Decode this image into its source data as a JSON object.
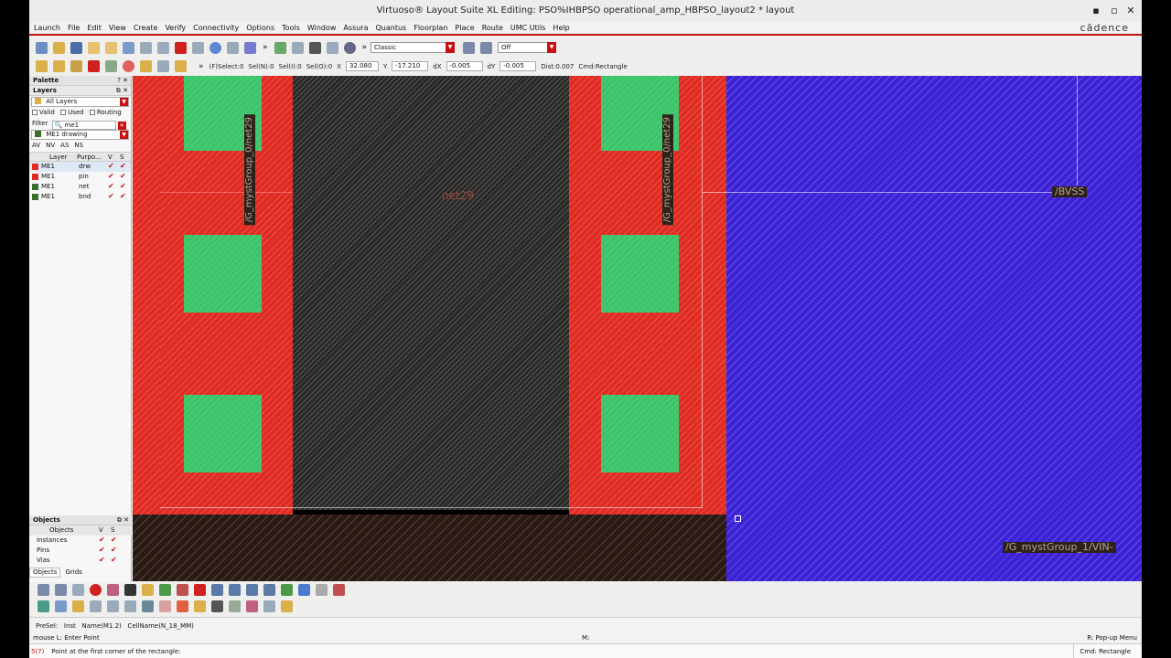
{
  "window": {
    "title": "Virtuoso® Layout Suite XL Editing: PSO%IHBPSO operational_amp_HBPSO_layout2 * layout",
    "minimize": "▪",
    "maximize": "▫",
    "close": "✕"
  },
  "menubar": {
    "items": [
      "Launch",
      "File",
      "Edit",
      "View",
      "Create",
      "Verify",
      "Connectivity",
      "Options",
      "Tools",
      "Window",
      "Assura",
      "Quantus",
      "Floorplan",
      "Place",
      "Route",
      "UMC Utils",
      "Help"
    ],
    "brand": "cādence"
  },
  "toolbar1": {
    "more": "»",
    "more2": "»",
    "mode_select": "Classic",
    "off_select": "Off"
  },
  "toolbar2": {
    "more": "»",
    "fselect": "(F)Select:0",
    "seln": "Sel(N):0",
    "seli": "Sel(I):0",
    "selo": "Sel(O):0",
    "x_label": "X",
    "x_value": "32.080",
    "y_label": "Y",
    "y_value": "-17.210",
    "dx_label": "dX",
    "dx_value": "-0.005",
    "dy_label": "dY",
    "dy_value": "-0.005",
    "dist": "Dist:0.007",
    "cmd": "Cmd:Rectangle"
  },
  "palette": {
    "title": "Palette",
    "layers_title": "Layers",
    "filter_scope": "All Layers",
    "valid": "Valid",
    "used": "Used",
    "routing": "Routing",
    "filter_label": "Filter",
    "filter_value": "me1",
    "current_layer": "ME1 drawing",
    "vis_buttons": [
      "AV",
      "NV",
      "AS",
      "NS"
    ],
    "columns": [
      "Layer",
      "Purpo...",
      "V",
      "S"
    ],
    "rows": [
      {
        "layer": "ME1",
        "purpose": "drw",
        "color": "#e02b22"
      },
      {
        "layer": "ME1",
        "purpose": "pin",
        "color": "#e02b22"
      },
      {
        "layer": "ME1",
        "purpose": "net",
        "color": "#3b6e2a"
      },
      {
        "layer": "ME1",
        "purpose": "bnd",
        "color": "#3b6e2a"
      }
    ]
  },
  "objects": {
    "title": "Objects",
    "columns": [
      "Objects",
      "V",
      "S"
    ],
    "rows": [
      "Instances",
      "Pins",
      "Vias"
    ],
    "tabs": [
      "Objects",
      "Grids"
    ]
  },
  "canvas": {
    "labels": {
      "left_vertical": "/G_mystGroup_0/net29",
      "right_vertical": "/G_mystGroup_0/net29",
      "net29": "net29",
      "bvss": "/BVSS",
      "vin": "/G_mystGroup_1/VIN-"
    }
  },
  "statusbar": {
    "presel": "PreSel:",
    "inst": "Inst",
    "name": "Name(M1.2)",
    "cellname": "CellName(N_18_MM)",
    "mouse": "mouse L: Enter Point",
    "mid": "M:",
    "right": "R: Pop-up Menu",
    "line_no": "5(7)",
    "prompt": "Point at the first corner of the rectangle:",
    "cmd": "Cmd: Rectangle"
  }
}
